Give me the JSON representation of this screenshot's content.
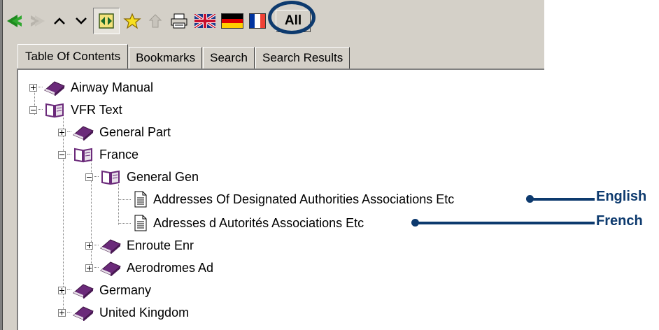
{
  "toolbar": {
    "icons": [
      "back-icon",
      "forward-icon",
      "up-icon",
      "down-icon",
      "sync-toc-icon",
      "favorites-icon",
      "home-icon",
      "print-icon",
      "uk-flag-icon",
      "german-flag-icon",
      "french-flag-icon"
    ],
    "all_label": "All"
  },
  "tabs": [
    {
      "label": "Table Of Contents",
      "active": true
    },
    {
      "label": "Bookmarks",
      "active": false
    },
    {
      "label": "Search",
      "active": false
    },
    {
      "label": "Search Results",
      "active": false
    }
  ],
  "tree": {
    "airway_manual": "Airway Manual",
    "vfr_text": "VFR Text",
    "general_part": "General Part",
    "france": "France",
    "general_gen": "General Gen",
    "doc_en": "Addresses Of Designated Authorities Associations Etc",
    "doc_fr": "Adresses d Autorités Associations Etc",
    "enroute": "Enroute Enr",
    "aerodromes": "Aerodromes Ad",
    "germany": "Germany",
    "united_kingdom": "United Kingdom"
  },
  "callouts": {
    "english": "English",
    "french": "French"
  },
  "colors": {
    "accent": "#0d3a6e",
    "book": "#6b2a7a",
    "arrow_green": "#1f8a1f"
  }
}
